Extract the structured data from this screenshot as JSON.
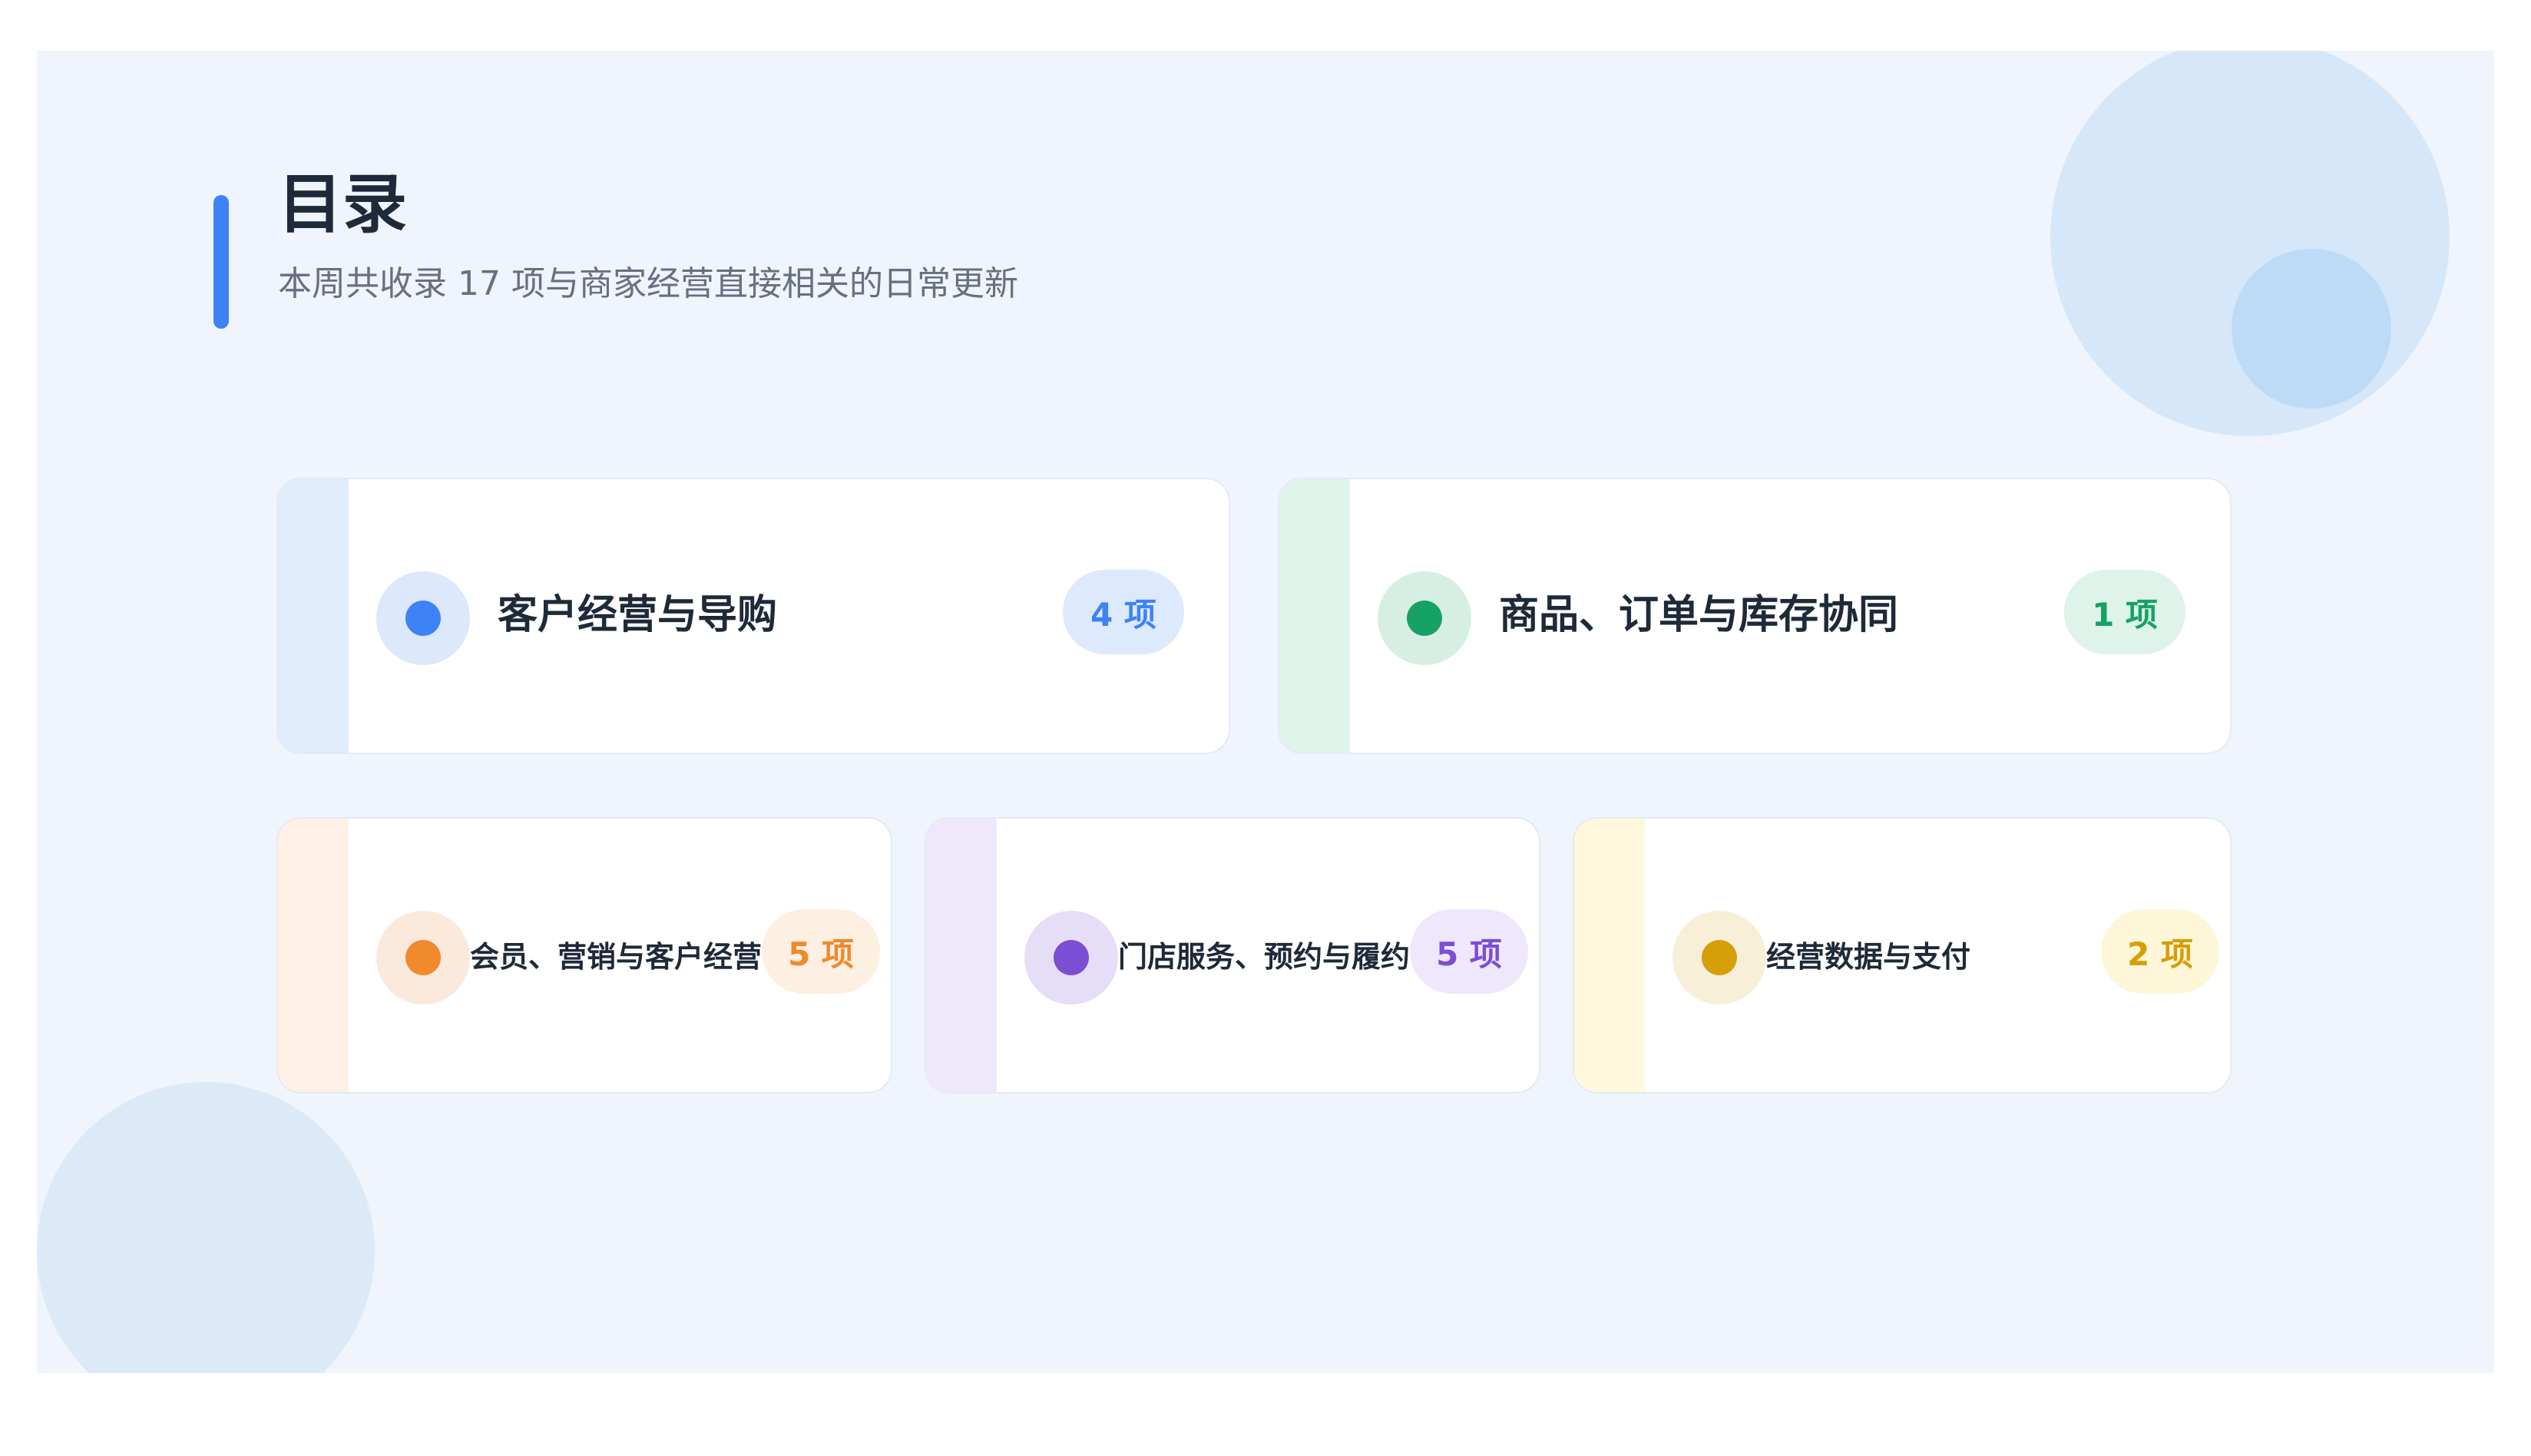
{
  "header": {
    "title": "目录",
    "subtitle": "本周共收录 17 项与商家经营直接相关的日常更新",
    "accent": "#3d82f6"
  },
  "cards": [
    {
      "label": "客户经营与导购",
      "badge": "4 项",
      "color": "#3d82f6",
      "icon": "blue-dot-icon"
    },
    {
      "label": "商品、订单与库存协同",
      "badge": "1 项",
      "color": "#16a165",
      "icon": "green-dot-icon"
    },
    {
      "label": "会员、营销与客户经营",
      "badge": "5 项",
      "color": "#f08a2c",
      "icon": "orange-dot-icon"
    },
    {
      "label": "门店服务、预约与履约",
      "badge": "5 项",
      "color": "#7c4ed4",
      "icon": "purple-dot-icon"
    },
    {
      "label": "经营数据与支付",
      "badge": "2 项",
      "color": "#d69e08",
      "icon": "yellow-dot-icon"
    }
  ]
}
